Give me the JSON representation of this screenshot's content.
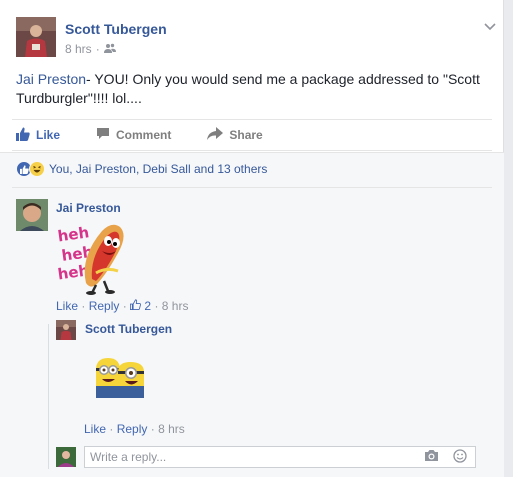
{
  "post": {
    "author": "Scott Tubergen",
    "time": "8 hrs",
    "audience_icon": "friends-icon",
    "mention": "Jai Preston",
    "text": "- YOU! Only you would send me a package addressed to \"Scott Turdburgler\"!!!! lol....",
    "actions": {
      "like": "Like",
      "comment": "Comment",
      "share": "Share"
    },
    "reactions_text": "You, Jai Preston, Debi Sall and 13 others"
  },
  "comments": [
    {
      "author": "Jai Preston",
      "sticker_text": "heh heh heh",
      "like": "Like",
      "reply": "Reply",
      "like_count": "2",
      "time": "8 hrs"
    }
  ],
  "reply": {
    "author": "Scott Tubergen",
    "like": "Like",
    "reply": "Reply",
    "time": "8 hrs"
  },
  "reply_box": {
    "placeholder": "Write a reply..."
  },
  "colors": {
    "link": "#365899",
    "action_blue": "#4267b2",
    "meta_gray": "#90949c"
  }
}
